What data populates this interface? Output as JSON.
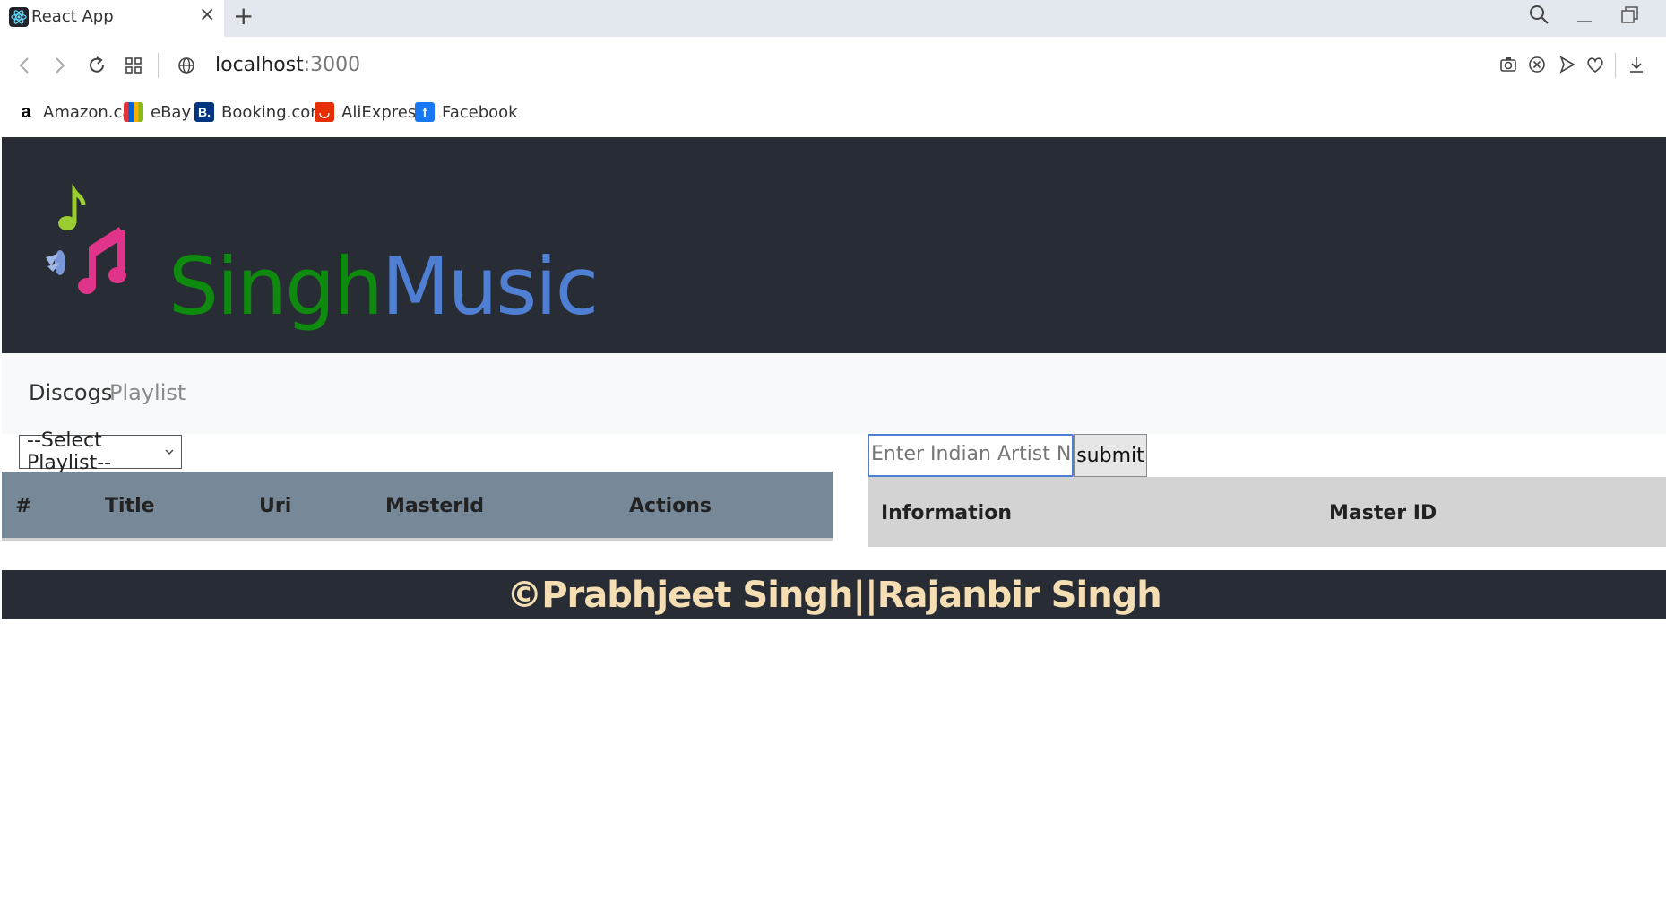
{
  "browser": {
    "tab_title": "React App",
    "tab_close_icon": "×",
    "new_tab_icon": "+",
    "url_host": "localhost",
    "url_port": ":3000",
    "bookmarks": [
      {
        "label": "Amazon.ca",
        "icon": "amazon-icon",
        "color": "#000000"
      },
      {
        "label": "eBay",
        "icon": "ebay-icon",
        "color": "#e53238"
      },
      {
        "label": "Booking.com",
        "icon": "booking-icon",
        "color": "#003580"
      },
      {
        "label": "AliExpress",
        "icon": "aliexpress-icon",
        "color": "#e62e04"
      },
      {
        "label": "Facebook",
        "icon": "facebook-icon",
        "color": "#1877f2"
      }
    ]
  },
  "header": {
    "brand_part1": "Singh",
    "brand_part2": "Music",
    "brand_color1": "#0e8a0e",
    "brand_color2": "#4f7fd3",
    "background": "#282c34"
  },
  "nav": {
    "items": [
      {
        "label": "Discogs",
        "active": true
      },
      {
        "label": "Playlist",
        "active": false
      }
    ]
  },
  "playlist": {
    "select_value": "--Select Playlist--",
    "columns": [
      "#",
      "Title",
      "Uri",
      "MasterId",
      "Actions"
    ]
  },
  "search": {
    "placeholder": "Enter Indian Artist Name...",
    "submit_label": "submit",
    "columns": [
      "Information",
      "Master ID"
    ]
  },
  "footer": {
    "text": "©Prabhjeet Singh||Rajanbir Singh"
  }
}
